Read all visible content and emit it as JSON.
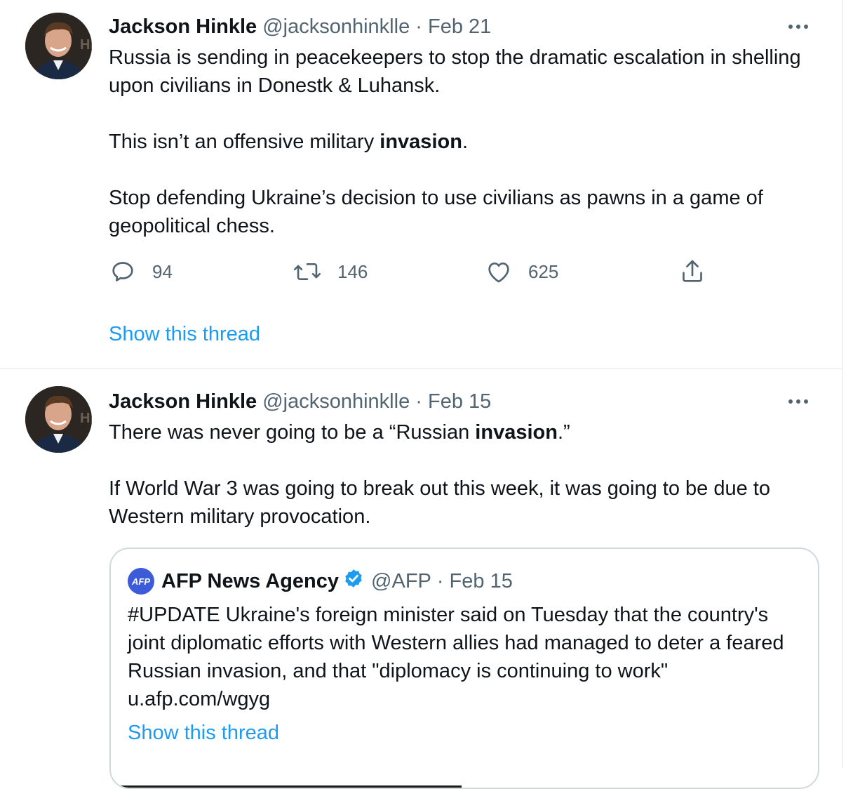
{
  "tweets": [
    {
      "name": "Jackson Hinkle",
      "handle": "@jacksonhinklle",
      "date_sep": "·",
      "date": "Feb 21",
      "paragraphs": [
        {
          "text": "Russia is sending in peacekeepers to stop the dramatic escalation in shelling upon civilians in Donestk & Luhansk."
        },
        {
          "pre": "This isn’t an offensive military ",
          "bold": "invasion",
          "post": "."
        },
        {
          "text": "Stop defending Ukraine’s decision to use civilians as pawns in a game of geopolitical chess."
        }
      ],
      "replies": "94",
      "retweets": "146",
      "likes": "625",
      "show_thread": "Show this thread"
    },
    {
      "name": "Jackson Hinkle",
      "handle": "@jacksonhinklle",
      "date_sep": "·",
      "date": "Feb 15",
      "paragraphs": [
        {
          "pre": "There was never going to be a “Russian ",
          "bold": "invasion",
          "post": ".”"
        },
        {
          "text": "If World War 3 was going to break out this week, it was going to be due to Western military provocation."
        }
      ],
      "quote": {
        "logo_text": "AFP",
        "name": "AFP News Agency",
        "handle": "@AFP",
        "date_sep": "·",
        "date": "Feb 15",
        "text": "#UPDATE Ukraine's foreign minister said on Tuesday that the country's joint diplomatic efforts with Western allies had managed to deter a feared Russian invasion, and that \"diplomacy is continuing to work\" u.afp.com/wgyg",
        "show_thread": "Show this thread"
      }
    }
  ],
  "icons": {
    "reply": "reply-icon",
    "retweet": "retweet-icon",
    "like": "heart-icon",
    "share": "share-icon",
    "more": "more-icon",
    "verified": "verified-badge-icon"
  },
  "colors": {
    "link": "#1d9bf0",
    "muted": "#536471",
    "text": "#0f1419",
    "verified": "#1d9bf0",
    "afp_logo": "#3b5bd9"
  }
}
